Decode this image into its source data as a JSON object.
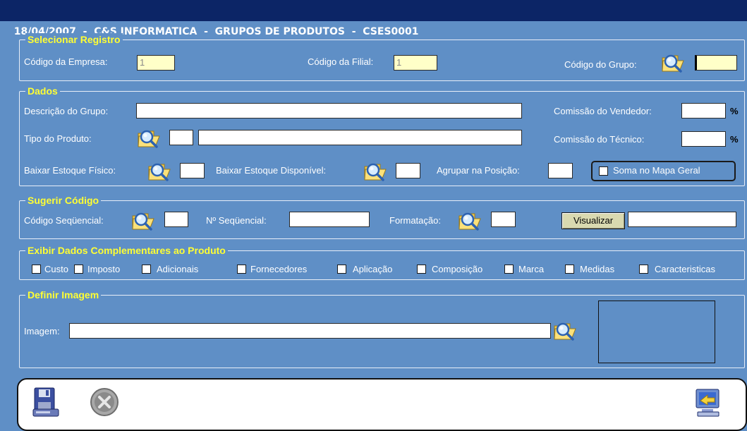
{
  "window": {
    "title": "18/04/2007  -  C&S INFORMATICA  -  GRUPOS DE PRODUTOS  -  CSES0001"
  },
  "selecionar": {
    "legend": "Selecionar Registro",
    "empresa_label": "Código da Empresa:",
    "empresa_value": "1",
    "filial_label": "Código da Filial:",
    "filial_value": "1",
    "grupo_label": "Código do Grupo:",
    "grupo_value": ""
  },
  "dados": {
    "legend": "Dados",
    "descricao_label": "Descrição do Grupo:",
    "descricao_value": "",
    "comissao_vendedor_label": "Comissão do Vendedor:",
    "comissao_vendedor_value": "",
    "tipo_label": "Tipo do Produto:",
    "tipo_code": "",
    "tipo_desc": "",
    "comissao_tecnico_label": "Comissão do Técnico:",
    "comissao_tecnico_value": "",
    "percent": "%",
    "baixar_fisico_label": "Baixar Estoque Físico:",
    "baixar_fisico_value": "",
    "baixar_disponivel_label": "Baixar Estoque Disponível:",
    "baixar_disponivel_value": "",
    "agrupar_label": "Agrupar na Posição:",
    "agrupar_value": "",
    "soma_label": "Soma no Mapa Geral"
  },
  "sugerir": {
    "legend": "Sugerir Código",
    "sequencial_label": "Código Seqüencial:",
    "sequencial_value": "",
    "numero_label": "Nº Seqüencial:",
    "numero_value": "",
    "formatacao_label": "Formatação:",
    "formatacao_value": "",
    "visualizar_button": "Visualizar",
    "visualizar_value": ""
  },
  "exibir": {
    "legend": "Exibir Dados Complementares ao Produto",
    "options": [
      "Custo",
      "Imposto",
      "Adicionais",
      "Fornecedores",
      "Aplicação",
      "Composição",
      "Marca",
      "Medidas",
      "Caracteristicas"
    ]
  },
  "imagem": {
    "legend": "Definir Imagem",
    "label": "Imagem:",
    "value": ""
  },
  "icons": {
    "lookup": "folder-search-icon",
    "save": "save-disk-icon",
    "cancel": "cancel-x-icon",
    "exit": "exit-computer-icon"
  },
  "colors": {
    "background": "#5f8fc6",
    "titlebar": "#0c2566",
    "legend_text": "#ffff33",
    "field_highlight": "#ffffc8"
  }
}
